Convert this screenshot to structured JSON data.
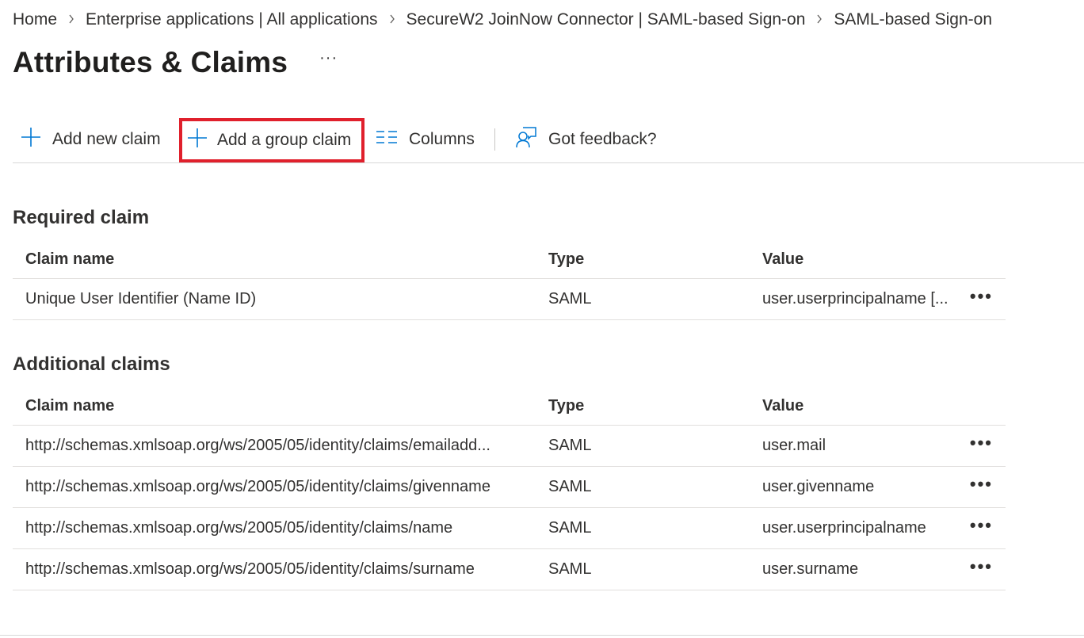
{
  "breadcrumb": {
    "items": [
      {
        "label": "Home"
      },
      {
        "label": "Enterprise applications | All applications"
      },
      {
        "label": "SecureW2 JoinNow Connector | SAML-based Sign-on"
      },
      {
        "label": "SAML-based Sign-on"
      }
    ],
    "separator_icon": "chevron-right-icon"
  },
  "page": {
    "title": "Attributes & Claims",
    "more_label": "···"
  },
  "toolbar": {
    "add_new_claim": "Add new claim",
    "add_group_claim": "Add a group claim",
    "columns": "Columns",
    "feedback": "Got feedback?",
    "accent_color": "#0078d4",
    "highlight_color": "#e0202c"
  },
  "required": {
    "title": "Required claim",
    "headers": {
      "name": "Claim name",
      "type": "Type",
      "value": "Value"
    },
    "rows": [
      {
        "name": "Unique User Identifier (Name ID)",
        "type": "SAML",
        "value": "user.userprincipalname [..."
      }
    ]
  },
  "additional": {
    "title": "Additional claims",
    "headers": {
      "name": "Claim name",
      "type": "Type",
      "value": "Value"
    },
    "rows": [
      {
        "name": "http://schemas.xmlsoap.org/ws/2005/05/identity/claims/emailadd...",
        "type": "SAML",
        "value": "user.mail"
      },
      {
        "name": "http://schemas.xmlsoap.org/ws/2005/05/identity/claims/givenname",
        "type": "SAML",
        "value": "user.givenname"
      },
      {
        "name": "http://schemas.xmlsoap.org/ws/2005/05/identity/claims/name",
        "type": "SAML",
        "value": "user.userprincipalname"
      },
      {
        "name": "http://schemas.xmlsoap.org/ws/2005/05/identity/claims/surname",
        "type": "SAML",
        "value": "user.surname"
      }
    ]
  },
  "row_more_label": "•••"
}
